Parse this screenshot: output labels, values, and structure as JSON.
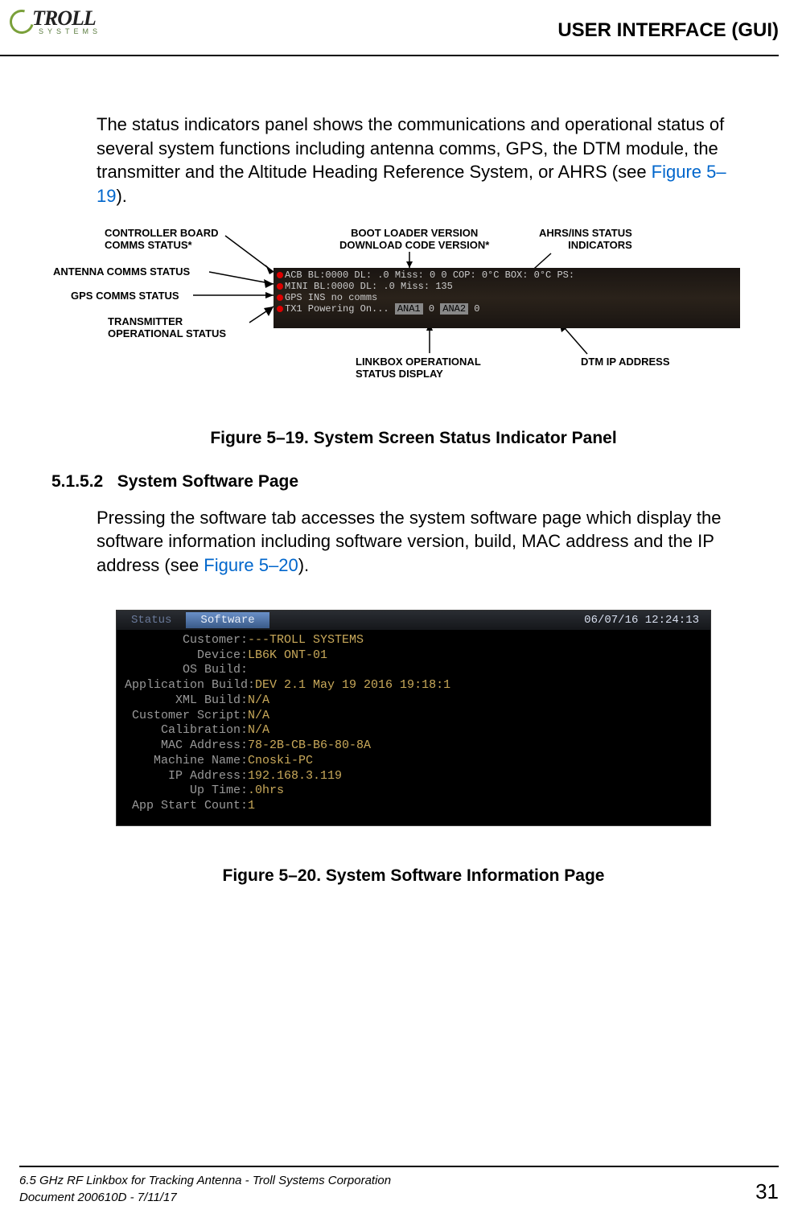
{
  "header": {
    "logo_main": "TROLL",
    "logo_sub": "SYSTEMS",
    "title": "USER INTERFACE (GUI)"
  },
  "intro": {
    "text_a": "The status indicators panel shows the communications and operational status of several system functions including antenna comms, GPS, the DTM module, the transmitter and the Altitude Heading Reference System, or AHRS (see ",
    "link": "Figure 5–19",
    "text_b": ")."
  },
  "callouts": {
    "controller": "CONTROLLER BOARD\nCOMMS STATUS*",
    "antenna": "ANTENNA COMMS STATUS",
    "gps": "GPS COMMS STATUS",
    "transmitter": "TRANSMITTER\nOPERATIONAL STATUS",
    "bootloader": "BOOT LOADER VERSION\nDOWNLOAD CODE VERSION*",
    "ahrs": "AHRS/INS STATUS\nINDICATORS",
    "linkbox": "LINKBOX OPERATIONAL\nSTATUS DISPLAY",
    "dtm": "DTM IP ADDRESS"
  },
  "status_panel": {
    "row1": "ACB BL:0000 DL:  .0 Miss:  0       0 COP: 0°C BOX: 0°C PS:",
    "row2": "MINI BL:0000 DL:  .0 Miss: 135",
    "row3": "GPS             INS no comms",
    "row4_a": "TX1    Powering On...  ",
    "row4_b": "ANA1",
    "row4_c": "  0 ",
    "row4_d": "ANA2",
    "row4_e": "  0"
  },
  "fig19_caption": "Figure 5–19.  System Screen Status Indicator Panel",
  "section": {
    "num": "5.1.5.2",
    "title": "System Software Page"
  },
  "sw_intro": {
    "text_a": "Pressing the software tab accesses the system software page which display the software information including software version, build, MAC address and the IP address (see ",
    "link": "Figure 5–20",
    "text_b": ")."
  },
  "software_page": {
    "tab_status": "Status",
    "tab_software": "Software",
    "timestamp": "06/07/16 12:24:13",
    "lines": [
      {
        "k": "        Customer:",
        "v": "---TROLL SYSTEMS"
      },
      {
        "k": "          Device:",
        "v": "LB6K ONT-01"
      },
      {
        "k": "        OS Build:",
        "v": ""
      },
      {
        "k": "Application Build:",
        "v": "DEV 2.1 May 19 2016 19:18:1"
      },
      {
        "k": "       XML Build:",
        "v": "N/A"
      },
      {
        "k": " Customer Script:",
        "v": "N/A"
      },
      {
        "k": "     Calibration:",
        "v": "N/A"
      },
      {
        "k": "     MAC Address:",
        "v": "78-2B-CB-B6-80-8A"
      },
      {
        "k": "    Machine Name:",
        "v": "Cnoski-PC"
      },
      {
        "k": "      IP Address:",
        "v": "192.168.3.119"
      },
      {
        "k": "         Up Time:",
        "v": ".0hrs"
      },
      {
        "k": " App Start Count:",
        "v": "1"
      }
    ]
  },
  "fig20_caption": "Figure 5–20.  System Software Information Page",
  "footer": {
    "line1": "6.5 GHz RF Linkbox for Tracking Antenna - Troll Systems Corporation",
    "line2": "Document 200610D - 7/11/17",
    "page": "31"
  }
}
